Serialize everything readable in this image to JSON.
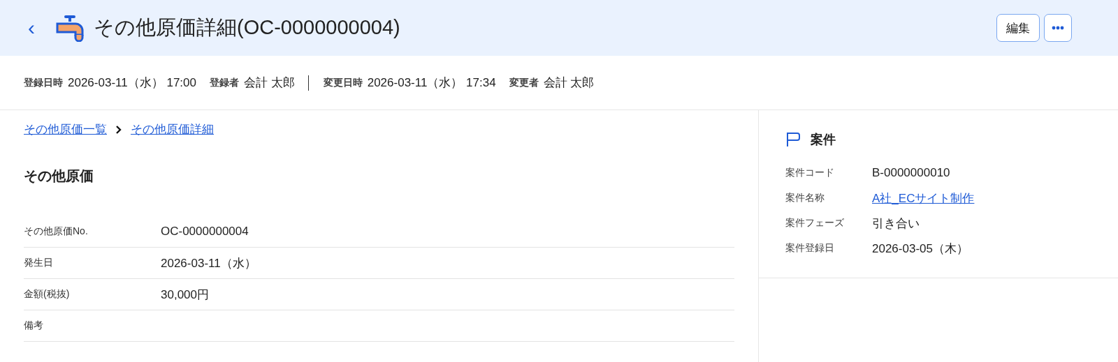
{
  "header": {
    "back": "‹",
    "title": "その他原価詳細(OC-0000000004)",
    "buttons": [
      {
        "kind": "text",
        "label": "編集"
      },
      {
        "kind": "more"
      }
    ]
  },
  "meta": [
    {
      "label": "登録日時",
      "value": "2026-03-11（水） 17:00"
    },
    {
      "label": "登録者",
      "value": "会計 太郎"
    },
    {
      "label": "変更日時",
      "value": "2026-03-11（水） 17:34"
    },
    {
      "label": "変更者",
      "value": "会計 太郎"
    }
  ],
  "breadcrumbs": [
    "その他原価一覧",
    "その他原価詳細"
  ],
  "section": {
    "title": "その他原価",
    "fields": [
      {
        "label": "その他原価No.",
        "value": "OC-0000000004"
      },
      {
        "label": "発生日",
        "value": "2026-03-11（水）"
      },
      {
        "label": "金額(税抜)",
        "value": "30,000円"
      },
      {
        "label": "備考"
      }
    ]
  },
  "project": {
    "title": "案件",
    "fields": [
      {
        "label": "案件コード",
        "value": "B-0000000010",
        "kind": "text"
      },
      {
        "label": "案件名称",
        "value": "A社_ECサイト制作",
        "kind": "link"
      },
      {
        "label": "案件フェーズ",
        "value": "引き合い",
        "kind": "text"
      },
      {
        "label": "案件登録日",
        "value": "2026-03-05（木）",
        "kind": "text"
      }
    ]
  }
}
